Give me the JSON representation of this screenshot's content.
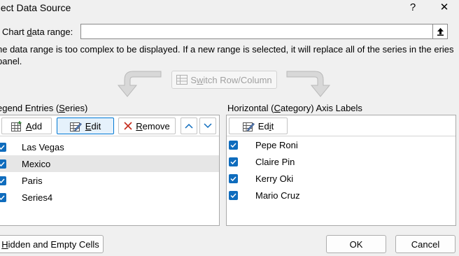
{
  "window": {
    "title": "elect Data Source",
    "help_label": "?",
    "close_label": "✕"
  },
  "range": {
    "label_pre": "Chart ",
    "label_mn": "d",
    "label_post": "ata range:",
    "value": "",
    "collapse_label": "⬆"
  },
  "note": "he data range is too complex to be displayed. If a new range is selected, it will replace all of the series in the eries panel.",
  "switch": {
    "label_pre": "S",
    "label_mn": "w",
    "label_post": "itch Row/Column"
  },
  "series_panel": {
    "label_pre": "egend Entries (",
    "label_mn": "S",
    "label_post": "eries)",
    "add_mn": "A",
    "add_post": "dd",
    "edit_mn": "E",
    "edit_post": "dit",
    "remove_mn": "R",
    "remove_post": "emove",
    "items": [
      {
        "label": "Las Vegas",
        "checked": true,
        "selected": false
      },
      {
        "label": "Mexico",
        "checked": true,
        "selected": true
      },
      {
        "label": "Paris",
        "checked": true,
        "selected": false
      },
      {
        "label": "Series4",
        "checked": true,
        "selected": false
      }
    ]
  },
  "axis_panel": {
    "label_pre": "Horizontal (",
    "label_mn": "C",
    "label_post": "ategory) Axis Labels",
    "edit_pre": "Ed",
    "edit_mn": "i",
    "edit_post": "t",
    "items": [
      {
        "label": "Pepe Roni",
        "checked": true
      },
      {
        "label": "Claire Pin",
        "checked": true
      },
      {
        "label": "Kerry Oki",
        "checked": true
      },
      {
        "label": "Mario Cruz",
        "checked": true
      }
    ]
  },
  "footer": {
    "hidden_mn": "H",
    "hidden_post": "idden and Empty Cells",
    "ok_label": "OK",
    "cancel_label": "Cancel"
  },
  "colors": {
    "accent": "#0f6cbd",
    "selected_row": "#e6e6e6",
    "remove_icon": "#c42b1c"
  }
}
